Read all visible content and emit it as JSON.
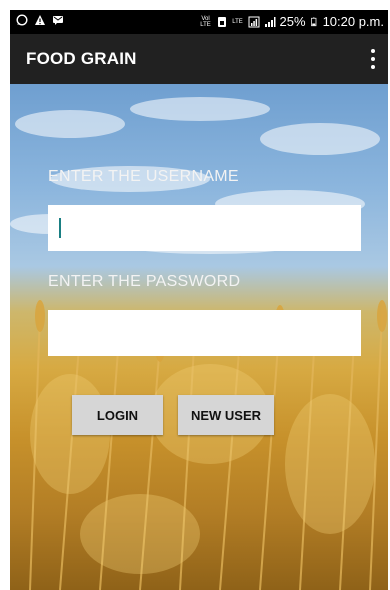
{
  "status_bar": {
    "left_icons": [
      "whatsapp-icon",
      "warning-icon",
      "message-icon"
    ],
    "volte_label": "Vol LTE",
    "lte_label": "LTE",
    "battery": "25%",
    "time": "10:20 p.m."
  },
  "app_bar": {
    "title": "FOOD GRAIN",
    "menu_icon": "overflow-menu-icon"
  },
  "form": {
    "username_label": "ENTER THE USERNAME",
    "username_value": "",
    "password_label": "ENTER THE PASSWORD",
    "password_value": "",
    "login_label": "LOGIN",
    "new_user_label": "NEW USER"
  },
  "colors": {
    "app_bar": "#212121",
    "status_bar": "#000000",
    "button_bg": "#d6d6d6",
    "cursor": "#1a7f83"
  }
}
